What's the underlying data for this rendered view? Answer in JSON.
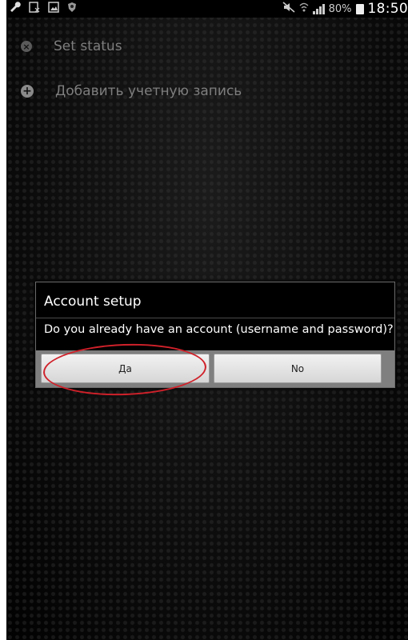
{
  "status_bar": {
    "icons_left": [
      "wrench-icon",
      "no-sim-icon",
      "image-icon",
      "shield-icon"
    ],
    "icons_right": [
      "mute-icon",
      "wifi-icon",
      "signal-icon"
    ],
    "battery_percent": "80%",
    "time": "18:50"
  },
  "menu": {
    "items": [
      {
        "label": "Set status",
        "icon": "status-icon"
      },
      {
        "label": "Добавить учетную запись",
        "icon": "add-icon"
      }
    ]
  },
  "dialog": {
    "title": "Account setup",
    "message": "Do you already have an account (username and password)?",
    "yes_label": "Да",
    "no_label": "No"
  },
  "colors": {
    "annotation": "#d0212a",
    "background": "#0e0e0e",
    "button_bar": "#7f7f7f"
  }
}
